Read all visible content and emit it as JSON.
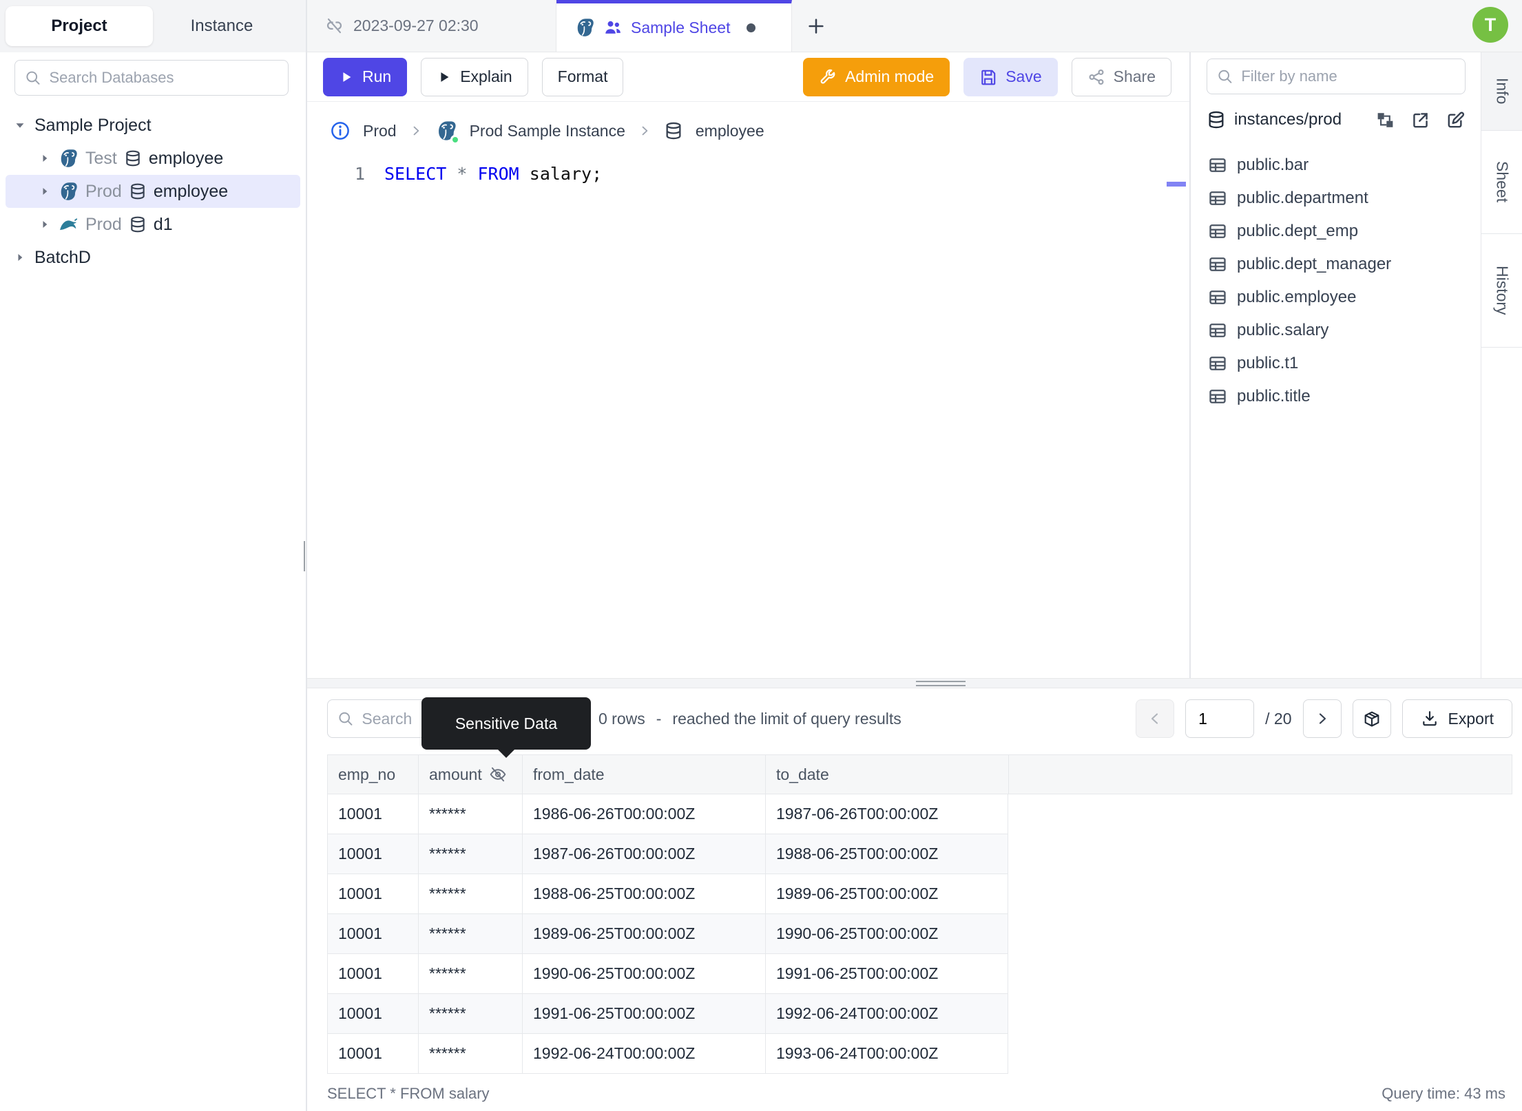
{
  "sidebar": {
    "tabs": [
      "Project",
      "Instance"
    ],
    "search_placeholder": "Search Databases",
    "tree": [
      {
        "label": "Sample Project"
      },
      {
        "env": "Test",
        "db": "employee"
      },
      {
        "env": "Prod",
        "db": "employee"
      },
      {
        "env": "Prod",
        "db": "d1"
      },
      {
        "label": "BatchD"
      }
    ]
  },
  "tabbar": {
    "tab1": "2023-09-27 02:30",
    "tab2": "Sample Sheet",
    "avatar": "T"
  },
  "toolbar": {
    "run": "Run",
    "explain": "Explain",
    "format": "Format",
    "admin_mode": "Admin mode",
    "save": "Save",
    "share": "Share"
  },
  "breadcrumb": {
    "env": "Prod",
    "instance": "Prod Sample Instance",
    "database": "employee"
  },
  "editor": {
    "line_number": "1",
    "kw1": "SELECT",
    "star": "*",
    "kw2": "FROM",
    "rest": "salary;"
  },
  "right_panel": {
    "filter_placeholder": "Filter by name",
    "db_path": "instances/prod",
    "tables": [
      "public.bar",
      "public.department",
      "public.dept_emp",
      "public.dept_manager",
      "public.employee",
      "public.salary",
      "public.t1",
      "public.title"
    ]
  },
  "side_tabs": [
    "Info",
    "Sheet",
    "History"
  ],
  "results": {
    "search_placeholder": "Search",
    "tooltip": "Sensitive Data",
    "rows_info": "0 rows",
    "dash": "-",
    "limit_info": "reached the limit of query results",
    "page": "1",
    "page_total": "/ 20",
    "export_label": "Export",
    "columns": [
      "emp_no",
      "amount",
      "from_date",
      "to_date"
    ],
    "rows": [
      [
        "10001",
        "******",
        "1986-06-26T00:00:00Z",
        "1987-06-26T00:00:00Z"
      ],
      [
        "10001",
        "******",
        "1987-06-26T00:00:00Z",
        "1988-06-25T00:00:00Z"
      ],
      [
        "10001",
        "******",
        "1988-06-25T00:00:00Z",
        "1989-06-25T00:00:00Z"
      ],
      [
        "10001",
        "******",
        "1989-06-25T00:00:00Z",
        "1990-06-25T00:00:00Z"
      ],
      [
        "10001",
        "******",
        "1990-06-25T00:00:00Z",
        "1991-06-25T00:00:00Z"
      ],
      [
        "10001",
        "******",
        "1991-06-25T00:00:00Z",
        "1992-06-24T00:00:00Z"
      ],
      [
        "10001",
        "******",
        "1992-06-24T00:00:00Z",
        "1993-06-24T00:00:00Z"
      ]
    ],
    "status_query": "SELECT * FROM salary",
    "query_time": "Query time: 43 ms"
  },
  "colors": {
    "accent": "#4f46e5",
    "admin_orange": "#f59e0b",
    "avatar_green": "#76c043",
    "sql_keyword": "#0000f0"
  }
}
